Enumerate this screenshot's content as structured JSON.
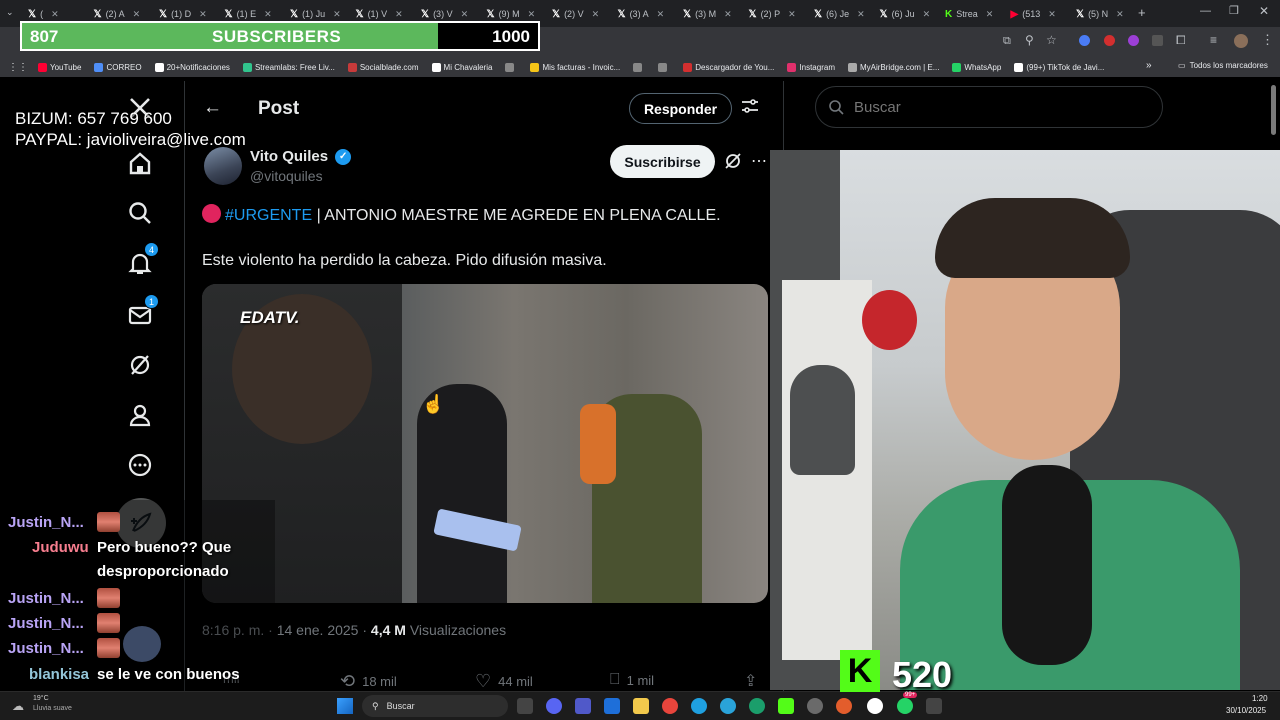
{
  "browser": {
    "tabs": [
      {
        "label": "(",
        "icon": "x-icon"
      },
      {
        "label": "(2) A",
        "icon": "x-icon"
      },
      {
        "label": "(1) D",
        "icon": "x-icon"
      },
      {
        "label": "(1) E",
        "icon": "x-icon"
      },
      {
        "label": "(1) Ju",
        "icon": "x-icon"
      },
      {
        "label": "(1) V",
        "icon": "x-icon"
      },
      {
        "label": "(3) V",
        "icon": "x-icon"
      },
      {
        "label": "(9) M",
        "icon": "x-icon"
      },
      {
        "label": "(2) V",
        "icon": "x-icon"
      },
      {
        "label": "(3) A",
        "icon": "x-icon"
      },
      {
        "label": "(3) M",
        "icon": "x-icon"
      },
      {
        "label": "(2) P",
        "icon": "x-icon"
      },
      {
        "label": "(6) Je",
        "icon": "x-icon"
      },
      {
        "label": "(6) Ju",
        "icon": "x-icon"
      },
      {
        "label": "Strea",
        "icon": "kick-icon"
      },
      {
        "label": "(513",
        "icon": "youtube-icon"
      },
      {
        "label": "(5) N",
        "icon": "x-icon"
      }
    ],
    "bookmarks": [
      "YouTube",
      "CORREO",
      "20+Notificaciones",
      "Streamlabs: Free Liv...",
      "Socialblade.com",
      "Mi Chavaleria",
      "",
      "Mis facturas - Invoic...",
      "",
      "",
      "Descargador de You...",
      "Instagram",
      "MyAirBridge.com | E...",
      "WhatsApp",
      "(99+) TikTok de Javi..."
    ],
    "all_bookmarks": "Todos los marcadores"
  },
  "overlay": {
    "subs_count": "807",
    "subs_label": "SUBSCRIBERS",
    "subs_goal": "1000",
    "subs_progress": 0.807,
    "bizum": "BIZUM: 657 769 600",
    "paypal": "PAYPAL: javioliveira@live.com",
    "viewers": "520",
    "kick_letter": "K"
  },
  "twitter": {
    "nav_badges": {
      "notifications": "4",
      "messages": "1"
    },
    "post_title": "Post",
    "reply_label": "Responder",
    "subscribe_label": "Suscribirse",
    "author_name": "Vito Quiles",
    "author_handle": "@vitoquiles",
    "hashtag": "#URGENTE",
    "headline": "| ANTONIO MAESTRE ME AGREDE EN PLENA CALLE.",
    "body": "Este violento ha perdido la cabeza. Pido difusión masiva.",
    "media_watermark": "EDATV.",
    "time": "8:16 p. m.",
    "date": "14 ene. 2025",
    "views_count": "4,4 M",
    "views_label": "Visualizaciones",
    "reposts": "18 mil",
    "likes": "44 mil",
    "bookmarks": "1 mil",
    "replies": "mil",
    "search_placeholder": "Buscar"
  },
  "chat": [
    {
      "user": "Justin_N...",
      "color": "#b9a4f5",
      "msg": ""
    },
    {
      "user": "Juduwu",
      "color": "#f77e8f",
      "msg": "Pero bueno?? Que desproporcionado"
    },
    {
      "user": "Justin_N...",
      "color": "#b9a4f5",
      "msg": ""
    },
    {
      "user": "Justin_N...",
      "color": "#b9a4f5",
      "msg": ""
    },
    {
      "user": "Justin_N...",
      "color": "#b9a4f5",
      "msg": ""
    },
    {
      "user": "blankisa",
      "color": "#93c5d8",
      "msg": "se le ve con buenos argumentos"
    }
  ],
  "taskbar": {
    "weather_temp": "19°C",
    "weather_desc": "Lluvia suave",
    "search": "Buscar",
    "time": "1:20",
    "date": "30/10/2025",
    "whatsapp_badge": "99+"
  }
}
